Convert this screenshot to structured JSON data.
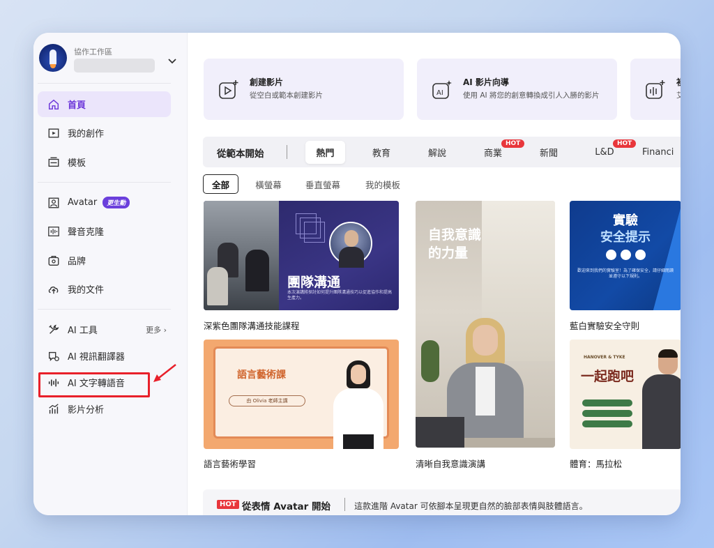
{
  "workspace": {
    "label": "協作工作區"
  },
  "sidebar": {
    "items": [
      {
        "label": "首頁"
      },
      {
        "label": "我的創作"
      },
      {
        "label": "模板"
      },
      {
        "label": "Avatar",
        "badge": "更生動"
      },
      {
        "label": "聲音克隆"
      },
      {
        "label": "品牌"
      },
      {
        "label": "我的文件"
      },
      {
        "label": "AI 工具",
        "more": "更多"
      },
      {
        "label": "AI 視訊翻譯器"
      },
      {
        "label": "AI 文字轉語音"
      },
      {
        "label": "影片分析"
      }
    ]
  },
  "cards": [
    {
      "title": "創建影片",
      "subtitle": "從空白或範本創建影片"
    },
    {
      "title": "AI 影片向導",
      "subtitle": "使用 AI 將您的創意轉換成引人入勝的影片"
    },
    {
      "title": "袓",
      "subtitle": "艾"
    }
  ],
  "templates": {
    "section_title": "從範本開始",
    "tabs": [
      "熱門",
      "教育",
      "解說",
      "商業",
      "新聞",
      "L&D",
      "Financi"
    ],
    "hot_badge": "HOT",
    "filters": [
      "全部",
      "橫螢幕",
      "垂直螢幕",
      "我的模板"
    ],
    "items": [
      {
        "caption": "深紫色團隊溝通技能課程",
        "thumb_title": "團隊溝通",
        "thumb_text": "本次演講將探討如何提升團隊溝通技巧以促進協作和提高生產力。"
      },
      {
        "caption": "清晰自我意識演講",
        "thumb_title_1": "自我意識",
        "thumb_title_2": "的力量"
      },
      {
        "caption": "藍白實驗安全守則",
        "thumb_title_1": "實驗",
        "thumb_title_2": "安全提示",
        "thumb_text": "歡迎來到我們的實驗室！為了確保安全，請仔細閱讀並遵守以下規則。"
      },
      {
        "caption": "語言藝術學習",
        "thumb_title": "語言藝術課",
        "thumb_pill": "由 Olivia 老師主講"
      },
      {
        "caption": "體育：馬拉松",
        "thumb_brand": "HANOVER & TYKE",
        "thumb_title": "一起跑吧"
      }
    ]
  },
  "bottom": {
    "badge": "HOT",
    "title": "從表情 Avatar 開始",
    "description": "這款進階 Avatar 可依腳本呈現更自然的臉部表情與肢體語言。"
  },
  "colors": {
    "accent": "#6b35d9",
    "hot": "#e8363b",
    "highlight": "#e8202a"
  }
}
